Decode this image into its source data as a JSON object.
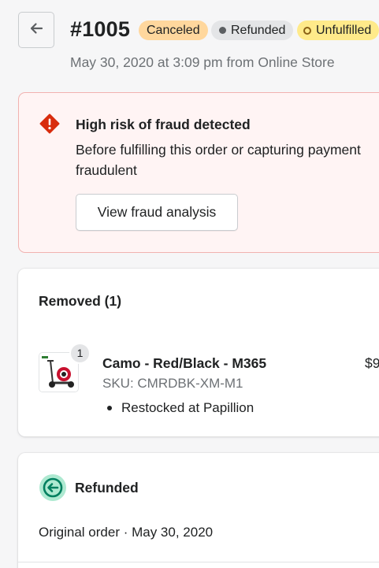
{
  "header": {
    "order_id": "#1005",
    "badges": {
      "canceled": "Canceled",
      "refunded": "Refunded",
      "unfulfilled": "Unfulfilled"
    },
    "subtitle": "May 30, 2020 at 3:09 pm from Online Store"
  },
  "fraud": {
    "title": "High risk of fraud detected",
    "body_line1": "Before fulfilling this order or capturing payment",
    "body_line2": "fraudulent",
    "button_label": "View fraud analysis",
    "color": "#d82c0d"
  },
  "removed": {
    "title": "Removed (1)",
    "item": {
      "quantity": "1",
      "name": "Camo - Red/Black - M365",
      "price": "$9",
      "sku": "SKU: CMRDBK-XM-M1",
      "note": "Restocked at Papillion"
    }
  },
  "refunded": {
    "title": "Refunded",
    "meta": "Original order · May 30, 2020",
    "color": "#007f5f"
  },
  "icons": {
    "back": "arrow-left-icon",
    "fraud": "alert-diamond-icon",
    "refund": "refund-circle-icon"
  }
}
